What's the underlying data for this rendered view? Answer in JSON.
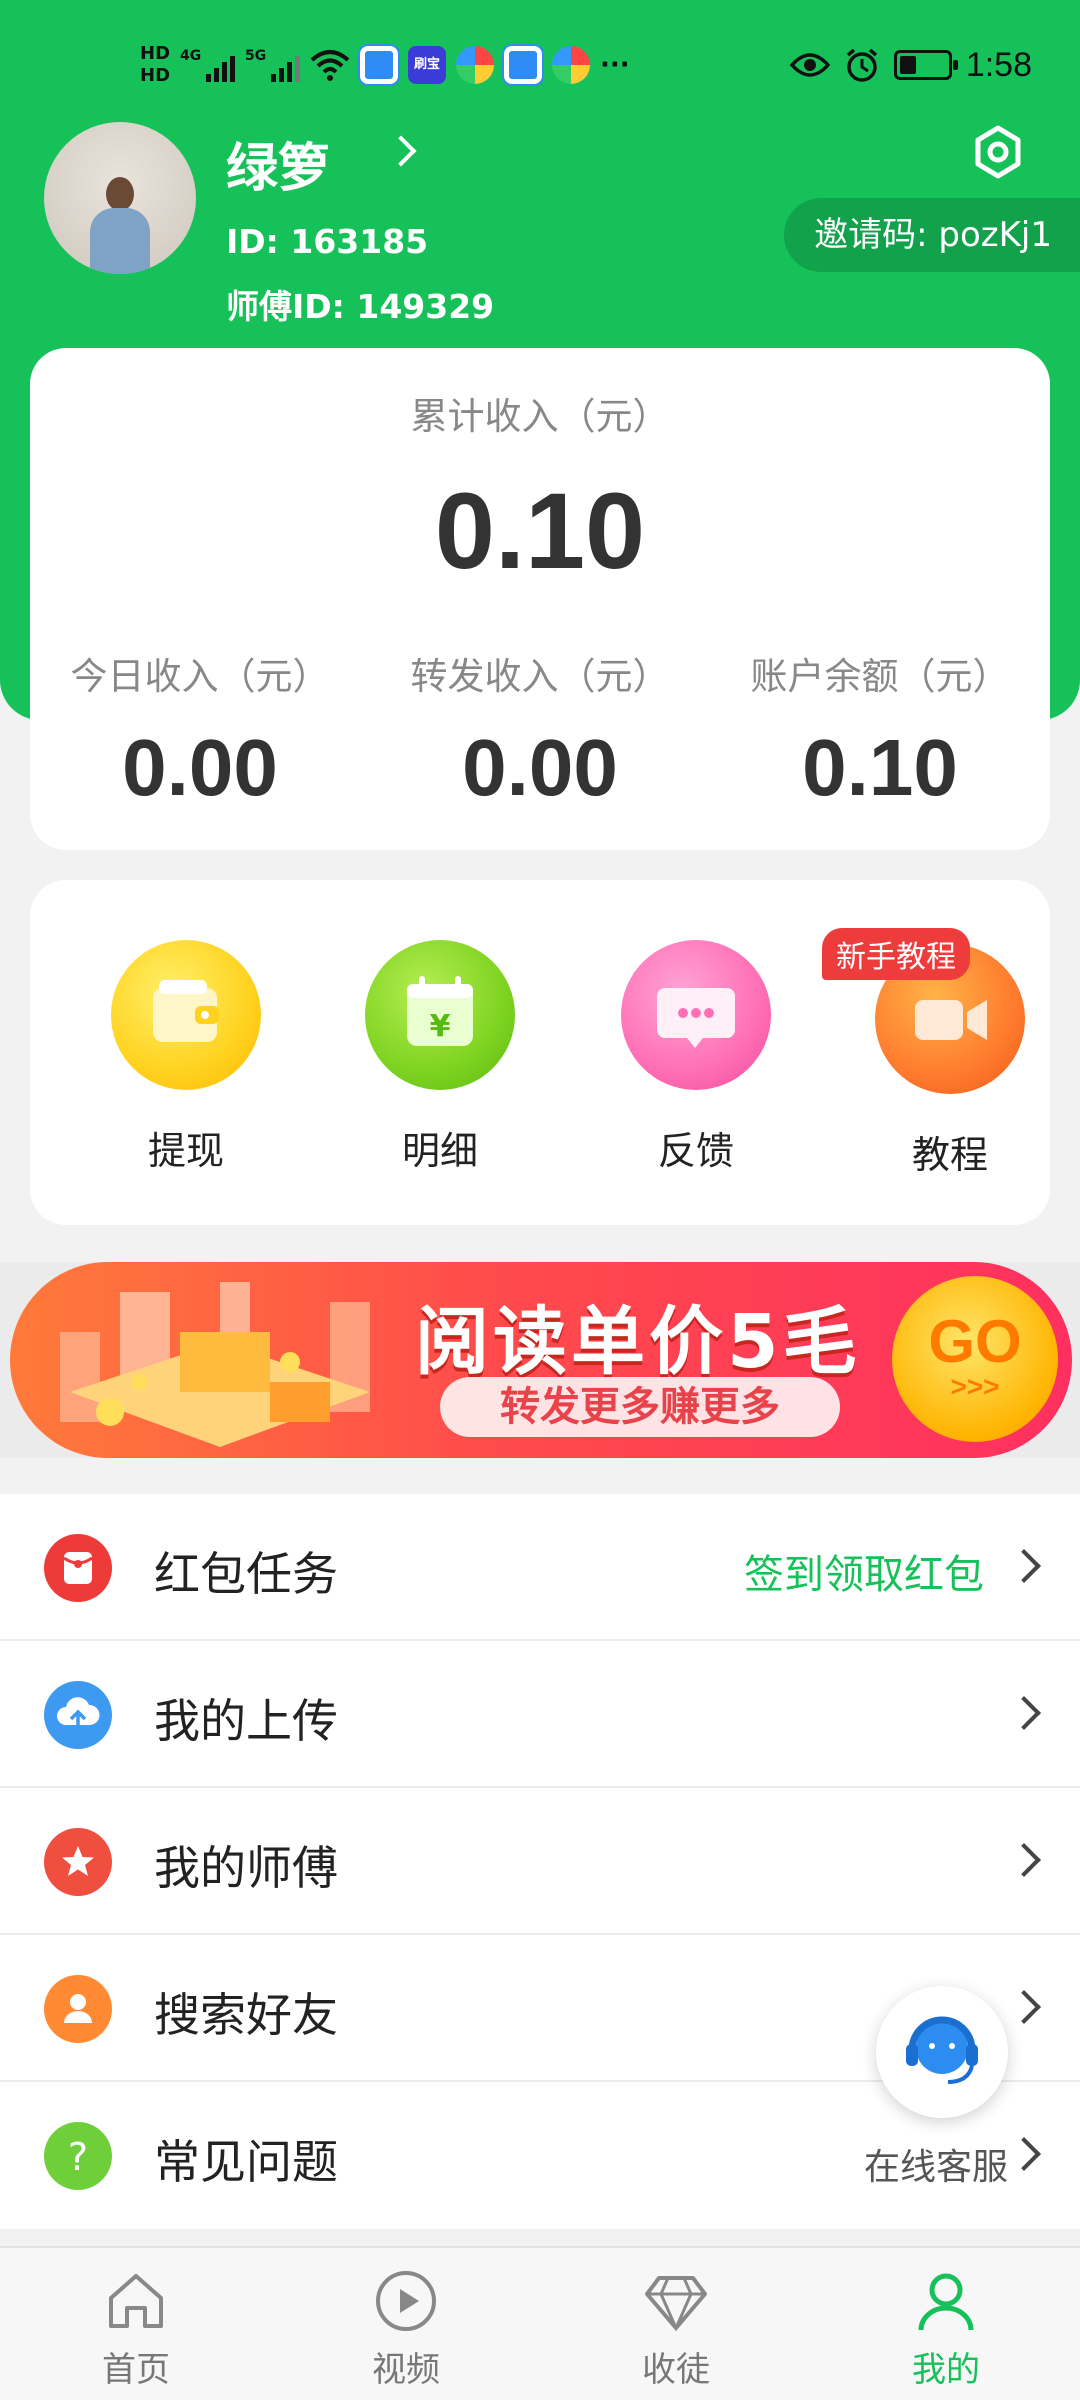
{
  "status_bar": {
    "hd1": "HD",
    "hd2": "HD",
    "net1": "4G",
    "net2": "5G",
    "app_badge": "刷宝",
    "more": "···",
    "time": "1:58"
  },
  "profile": {
    "name": "绿箩",
    "id_text": "ID: 163185",
    "master_id_text": "师傅ID:  149329",
    "invite_code_text": "邀请码: pozKj1"
  },
  "income": {
    "total_label": "累计收入（元）",
    "total_value": "0.10",
    "stats": [
      {
        "label": "今日收入（元）",
        "value": "0.00"
      },
      {
        "label": "转发收入（元）",
        "value": "0.00"
      },
      {
        "label": "账户余额（元）",
        "value": "0.10"
      }
    ]
  },
  "quick_actions": [
    {
      "label": "提现",
      "icon": "wallet-icon",
      "color": "#ffd21f"
    },
    {
      "label": "明细",
      "icon": "calendar-yuan-icon",
      "color": "#7ed321"
    },
    {
      "label": "反馈",
      "icon": "chat-bubble-icon",
      "color": "#ff6fb5"
    },
    {
      "label": "教程",
      "icon": "video-camera-icon",
      "color": "#ff7b2e"
    }
  ],
  "tutorial_badge": "新手教程",
  "banner": {
    "title": "阅读单价5毛",
    "subtitle": "转发更多赚更多",
    "go_text": "GO",
    "go_arrows": ">>>"
  },
  "menu": [
    {
      "label": "红包任务",
      "extra": "签到领取红包",
      "icon": "red-packet-icon",
      "color": "#ef3a3a"
    },
    {
      "label": "我的上传",
      "extra": "",
      "icon": "cloud-upload-icon",
      "color": "#3d9af0"
    },
    {
      "label": "我的师傅",
      "extra": "",
      "icon": "star-icon",
      "color": "#f04e3e"
    },
    {
      "label": "搜索好友",
      "extra": "",
      "icon": "person-icon",
      "color": "#ff8a33"
    },
    {
      "label": "常见问题",
      "extra": "",
      "icon": "question-icon",
      "color": "#6fcf3a"
    }
  ],
  "service": {
    "label": "在线客服"
  },
  "nav": [
    {
      "label": "首页",
      "icon": "home-icon",
      "active": false
    },
    {
      "label": "视频",
      "icon": "play-icon",
      "active": false
    },
    {
      "label": "收徒",
      "icon": "diamond-icon",
      "active": false
    },
    {
      "label": "我的",
      "icon": "user-icon",
      "active": true
    }
  ],
  "colors": {
    "brand_green": "#17c15a",
    "invite_bg": "#12a24b",
    "badge_red": "#ee3b3b"
  }
}
